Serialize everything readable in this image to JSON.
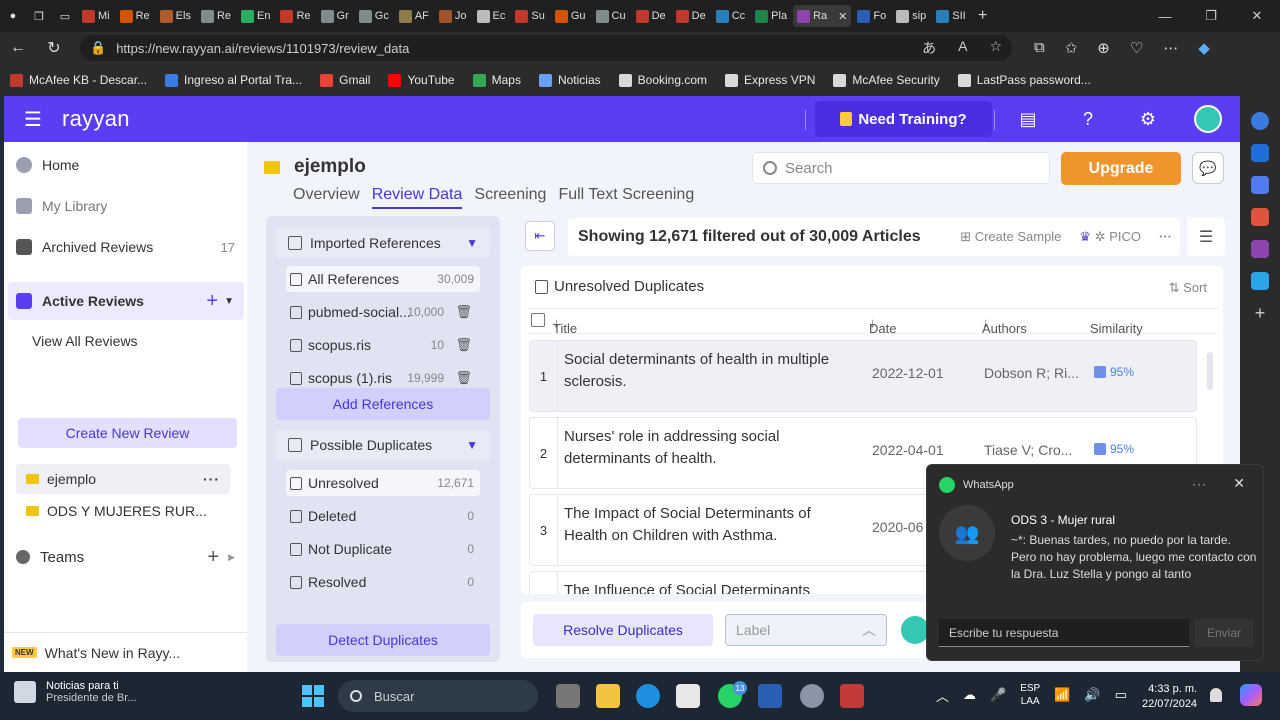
{
  "browser": {
    "tabs": [
      "Mi",
      "Re",
      "Els",
      "Re",
      "En",
      "Re",
      "Gr",
      "Gc",
      "AF",
      "Jo",
      "Ec",
      "Su",
      "Gu",
      "Cu",
      "De",
      "De",
      "Cc",
      "Pla",
      "Ra",
      "Fo",
      "sip",
      "SII"
    ],
    "active_tab": "Ra",
    "url": "https://new.rayyan.ai/reviews/1101973/review_data",
    "bookmarks": [
      "McAfee KB - Descar...",
      "Ingreso al Portal Tra...",
      "Gmail",
      "YouTube",
      "Maps",
      "Noticias",
      "Booking.com",
      "Express VPN",
      "McAfee Security",
      "LastPass password..."
    ],
    "bookmark_colors": [
      "#c0392b",
      "#3b7be0",
      "#ea4335",
      "#ff0000",
      "#34a853",
      "#6aa0f5",
      "#d9d9d9",
      "#d9d9d9",
      "#d9d9d9",
      "#d9d9d9"
    ]
  },
  "app": {
    "logo": "rayyan",
    "training": "Need Training?",
    "accent": "#5b3ef4",
    "upgrade": "Upgrade",
    "search_placeholder": "Search"
  },
  "sidebar": {
    "home": "Home",
    "library": "My Library",
    "archived": "Archived Reviews",
    "archived_count": "17",
    "active": "Active Reviews",
    "view_all": "View All Reviews",
    "create_new": "Create New Review",
    "reviews": [
      "ejemplo",
      "ODS Y MUJERES RUR..."
    ],
    "teams": "Teams",
    "new_tag": "NEW",
    "whats_new": "What's New in Rayy..."
  },
  "review": {
    "title": "ejemplo",
    "tabs": [
      "Overview",
      "Review Data",
      "Screening",
      "Full Text Screening"
    ],
    "active_tab": "Review Data"
  },
  "references": {
    "imported_header": "Imported References",
    "all_label": "All References",
    "all_count": "30,009",
    "files": [
      {
        "name": "pubmed-social...",
        "count": "10,000"
      },
      {
        "name": "scopus.ris",
        "count": "10"
      },
      {
        "name": "scopus (1).ris",
        "count": "19,999"
      }
    ],
    "add_button": "Add References",
    "duplicates_header": "Possible Duplicates",
    "duplicates": [
      {
        "name": "Unresolved",
        "count": "12,671"
      },
      {
        "name": "Deleted",
        "count": "0"
      },
      {
        "name": "Not Duplicate",
        "count": "0"
      },
      {
        "name": "Resolved",
        "count": "0"
      }
    ],
    "detect_button": "Detect Duplicates"
  },
  "articles": {
    "showing": "Showing 12,671 filtered out of 30,009 Articles",
    "create_sample": "Create Sample",
    "pico": "PICO",
    "section_title": "Unresolved Duplicates",
    "sort": "Sort",
    "columns": {
      "title": "Title",
      "date": "Date",
      "authors": "Authors",
      "similarity": "Similarity"
    },
    "rows": [
      {
        "idx": "1",
        "title": "Social determinants of health in multiple sclerosis.",
        "date": "2022-12-01",
        "authors": "Dobson R; Ri...",
        "similarity": "95%"
      },
      {
        "idx": "2",
        "title": "Nurses' role in addressing social determinants of health.",
        "date": "2022-04-01",
        "authors": "Tiase V; Cro...",
        "similarity": "95%"
      },
      {
        "idx": "3",
        "title": "The Impact of Social Determinants of Health on Children with Asthma.",
        "date": "2020-06",
        "authors": "",
        "similarity": ""
      },
      {
        "idx": "",
        "title": "The Influence of Social Determinants",
        "date": "",
        "authors": "",
        "similarity": ""
      }
    ],
    "resolve_button": "Resolve Duplicates",
    "label_placeholder": "Label"
  },
  "whatsapp": {
    "app": "WhatsApp",
    "group": "ODS 3 - Mujer rural",
    "message": "~*: Buenas tardes, no puedo por la tarde. Pero no hay problema, luego me contacto con la Dra. Luz Stella y pongo al tanto",
    "reply_placeholder": "Escribe tu respuesta",
    "send": "Enviar"
  },
  "taskbar": {
    "news_title": "Noticias para ti",
    "news_sub": "Presidente de Br...",
    "search": "Buscar",
    "whatsapp_badge": "13",
    "lang_top": "ESP",
    "lang_bottom": "LAA",
    "time": "4:33 p. m.",
    "date": "22/07/2024"
  }
}
